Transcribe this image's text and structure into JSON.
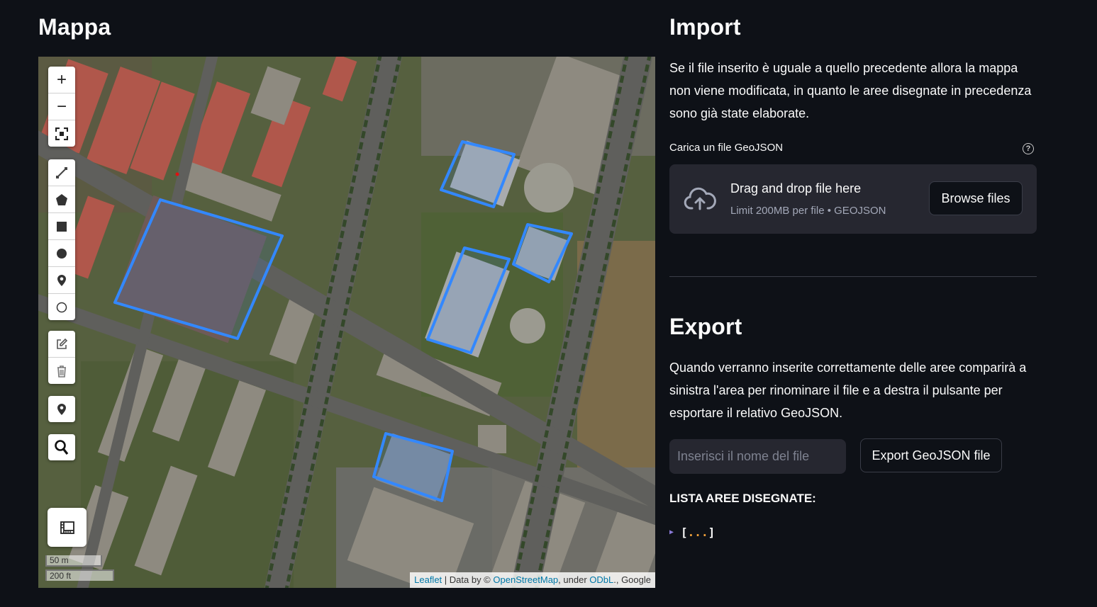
{
  "left": {
    "title": "Mappa",
    "map": {
      "scale_metric": "50 m",
      "scale_imperial": "200 ft",
      "attribution": {
        "leaflet": "Leaflet",
        "sep1": " | Data by © ",
        "osm": "OpenStreetMap",
        "sep2": ", under ",
        "odbl": "ODbL",
        "sep3": "., Google"
      },
      "controls": {
        "zoom_in": "+",
        "zoom_out": "−"
      }
    }
  },
  "right": {
    "import": {
      "title": "Import",
      "description": "Se il file inserito è uguale a quello precedente allora la mappa non viene modificata, in quanto le aree disegnate in precedenza sono già state elaborate.",
      "uploader_label": "Carica un file GeoJSON",
      "help": "?",
      "dropzone_title": "Drag and drop file here",
      "dropzone_limit": "Limit 200MB per file • GEOJSON",
      "browse_button": "Browse files"
    },
    "export": {
      "title": "Export",
      "description": "Quando verranno inserite correttamente delle aree comparirà a sinistra l'area per rinominare il file e a destra il pulsante per esportare il relativo GeoJSON.",
      "filename_placeholder": "Inserisci il nome del file",
      "filename_value": "",
      "export_button": "Export GeoJSON file",
      "list_title": "LISTA AREE DISEGNATE:",
      "json_open": "[",
      "json_dots": "...",
      "json_close": "]"
    }
  },
  "colors": {
    "background": "#0e1117",
    "panel": "#262730",
    "polygon_stroke": "#3388ff"
  }
}
